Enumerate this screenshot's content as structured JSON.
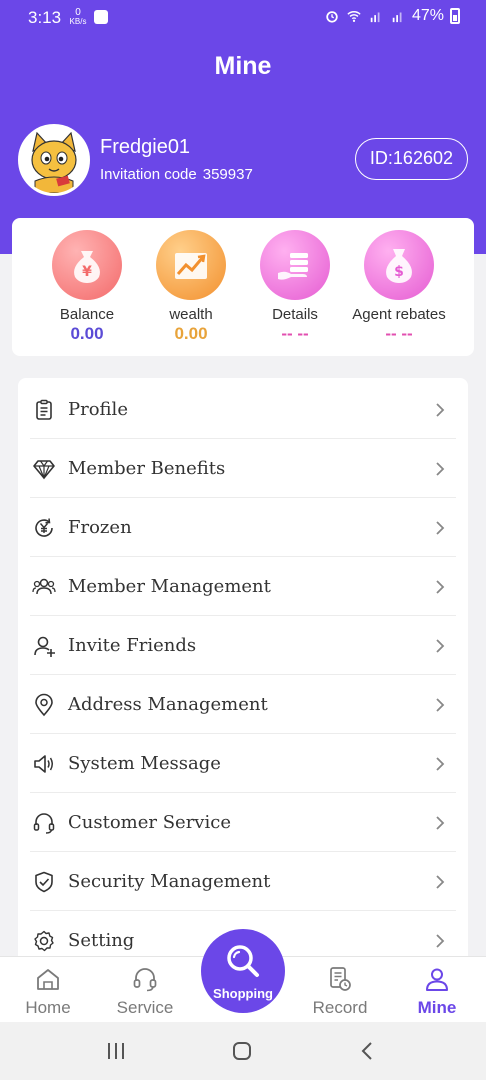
{
  "status_bar": {
    "time": "3:13",
    "net_speed_value": "0",
    "net_speed_unit": "KB/s",
    "battery": "47%"
  },
  "header": {
    "title": "Mine"
  },
  "user": {
    "name": "Fredgie01",
    "invite_label": "Invitation code",
    "invite_code": "359937",
    "id_badge": "ID:162602"
  },
  "stats": [
    {
      "label": "Balance",
      "value": "0.00",
      "color": "#5b4bd6",
      "icon": "money-bag-yen-icon"
    },
    {
      "label": "wealth",
      "value": "0.00",
      "color": "#e8a33a",
      "icon": "growth-chart-icon"
    },
    {
      "label": "Details",
      "value": "-- --",
      "color": "#e24fb0",
      "icon": "hand-coins-icon"
    },
    {
      "label": "Agent rebates",
      "value": "-- --",
      "color": "#e24fb0",
      "icon": "money-bag-dollar-icon"
    }
  ],
  "menu": [
    {
      "label": "Profile",
      "icon": "clipboard-icon"
    },
    {
      "label": "Member Benefits",
      "icon": "diamond-icon"
    },
    {
      "label": "Frozen",
      "icon": "yen-cycle-icon"
    },
    {
      "label": "Member Management",
      "icon": "users-icon"
    },
    {
      "label": "Invite Friends",
      "icon": "user-add-icon"
    },
    {
      "label": "Address Management",
      "icon": "location-pin-icon"
    },
    {
      "label": "System Message",
      "icon": "speaker-icon"
    },
    {
      "label": "Customer Service",
      "icon": "headset-icon"
    },
    {
      "label": "Security Management",
      "icon": "shield-check-icon"
    },
    {
      "label": "Setting",
      "icon": "gear-icon"
    }
  ],
  "tabs": [
    {
      "label": "Home",
      "icon": "home-icon"
    },
    {
      "label": "Service",
      "icon": "headset-icon"
    },
    {
      "label": "Shopping",
      "icon": "search-icon"
    },
    {
      "label": "Record",
      "icon": "record-clock-icon"
    },
    {
      "label": "Mine",
      "icon": "person-icon",
      "active": true
    }
  ],
  "colors": {
    "accent": "#6b47e8",
    "background": "#f2f2f4"
  }
}
